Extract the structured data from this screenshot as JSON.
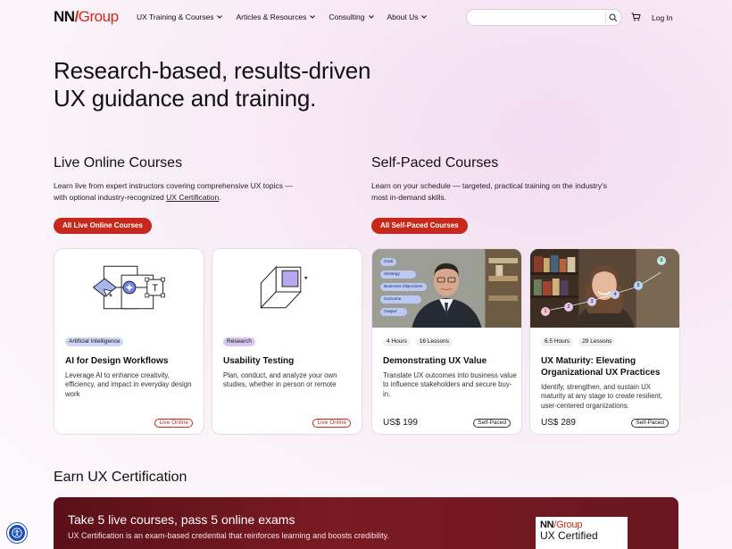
{
  "header": {
    "logo_nn": "NN",
    "logo_slash": "/",
    "logo_group": "Group",
    "nav": [
      "UX Training & Courses",
      "Articles & Resources",
      "Consulting",
      "About Us"
    ],
    "search_placeholder": "",
    "login": "Log In"
  },
  "hero": {
    "line1": "Research-based, results-driven",
    "line2": "UX guidance and training."
  },
  "live": {
    "title": "Live Online Courses",
    "desc_pre": "Learn live from expert instructors covering comprehensive UX topics — with optional industry-recognized ",
    "desc_link": "UX Certification",
    "desc_post": ".",
    "button": "All Live Online Courses"
  },
  "self": {
    "title": "Self-Paced Courses",
    "desc": "Learn on your schedule — targeted, practical training on the industry’s most in-demand skills.",
    "button": "All Self-Paced Courses"
  },
  "cards": [
    {
      "tag": "Artificial Intelligence",
      "title": "AI for Design Workflows",
      "desc": "Leverage AI to enhance creativity, efficiency, and impact in everyday design work",
      "badge": "Live Online",
      "illus_letter": "T"
    },
    {
      "tag": "Research",
      "title": "Usability Testing",
      "desc": "Plan, conduct, and analyze your own studies, whether in person or remote",
      "badge": "Live Online"
    },
    {
      "hours": "4 Hours",
      "lessons": "16 Lessons",
      "title": "Demonstrating UX Value",
      "desc": "Translate UX outcomes into business value to influence stakeholders and secure buy-in.",
      "price": "US$ 199",
      "badge": "Self-Paced",
      "chips": [
        "Goal",
        "Strategy",
        "Business Objectives",
        "Outcome",
        "Output"
      ]
    },
    {
      "hours": "6.5 Hours",
      "lessons": "29 Lessons",
      "title": "UX Maturity: Elevating Organizational UX Practices",
      "desc": "Identify, strengthen, and sustain UX maturity at any stage to create resilient, user-centered organizations.",
      "price": "US$ 289",
      "badge": "Self-Paced",
      "steps": [
        "1",
        "2",
        "3",
        "4",
        "5",
        "6"
      ]
    }
  ],
  "cert": {
    "title": "Earn UX Certification",
    "headline": "Take 5 live courses, pass 5 online exams",
    "sub": "UX Certification is an exam-based credential that reinforces learning and boosts credibility.",
    "logo_nn": "NN",
    "logo_slash": "/",
    "logo_group": "Group",
    "logo_cert": "UX Certified"
  },
  "colors": {
    "brand_red": "#c8281b",
    "cert_bg": "#6b1620",
    "a11y_blue": "#1c4fb4"
  }
}
